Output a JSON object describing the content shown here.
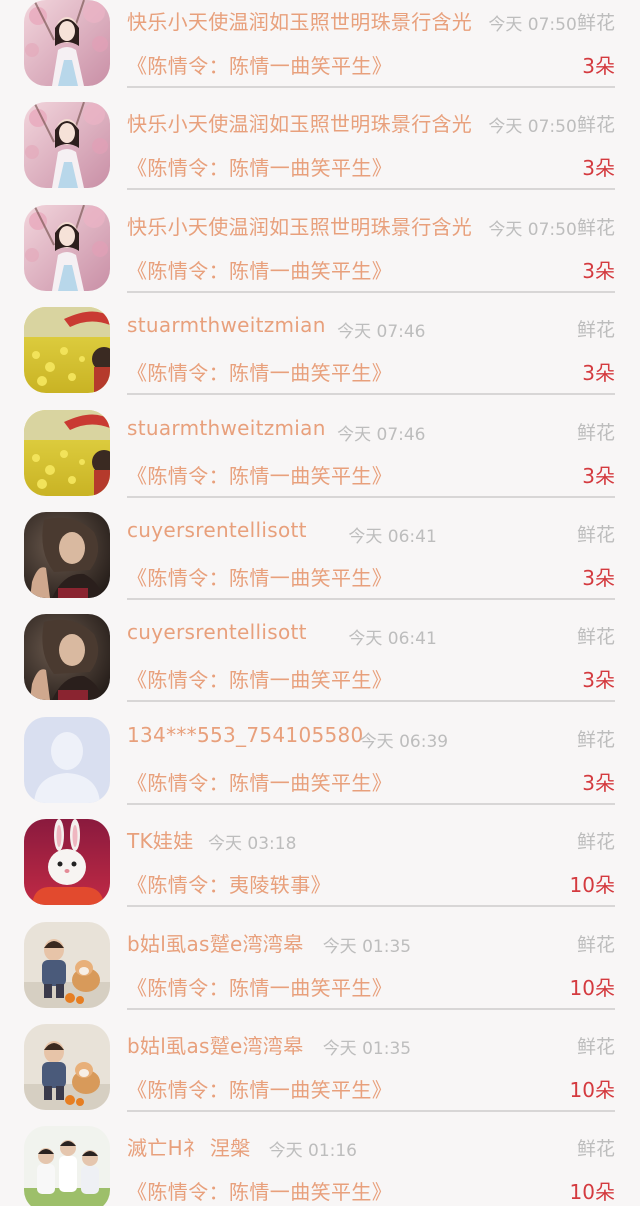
{
  "records": [
    {
      "avatar": "avatar-girl-pink-blossoms",
      "user": "快乐小天使温润如玉照世明珠景行含光",
      "time": "今天 07:50",
      "gift": "鲜花",
      "work": "《陈情令：陈情一曲笑平生》",
      "count": "3朵"
    },
    {
      "avatar": "avatar-girl-pink-blossoms",
      "user": "快乐小天使温润如玉照世明珠景行含光",
      "time": "今天 07:50",
      "gift": "鲜花",
      "work": "《陈情令：陈情一曲笑平生》",
      "count": "3朵"
    },
    {
      "avatar": "avatar-girl-pink-blossoms",
      "user": "快乐小天使温润如玉照世明珠景行含光",
      "time": "今天 07:50",
      "gift": "鲜花",
      "work": "《陈情令：陈情一曲笑平生》",
      "count": "3朵"
    },
    {
      "avatar": "avatar-yellow-flower-field",
      "user": "stuarmthweitzmian",
      "time": "今天 07:46",
      "gift": "鲜花",
      "work": "《陈情令：陈情一曲笑平生》",
      "count": "3朵"
    },
    {
      "avatar": "avatar-yellow-flower-field",
      "user": "stuarmthweitzmian",
      "time": "今天 07:46",
      "gift": "鲜花",
      "work": "《陈情令：陈情一曲笑平生》",
      "count": "3朵"
    },
    {
      "avatar": "avatar-woman-looking-up",
      "user": "cuyersrentellisott",
      "time": "今天 06:41",
      "gift": "鲜花",
      "work": "《陈情令：陈情一曲笑平生》",
      "count": "3朵"
    },
    {
      "avatar": "avatar-woman-looking-up",
      "user": "cuyersrentellisott",
      "time": "今天 06:41",
      "gift": "鲜花",
      "work": "《陈情令：陈情一曲笑平生》",
      "count": "3朵"
    },
    {
      "avatar": "avatar-default-placeholder",
      "user": "134***553_754105580",
      "time": "今天 06:39",
      "gift": "鲜花",
      "work": "《陈情令：陈情一曲笑平生》",
      "count": "3朵"
    },
    {
      "avatar": "avatar-white-rabbit",
      "user": "TK娃娃",
      "time": "今天 03:18",
      "gift": "鲜花",
      "work": "《陈情令：夷陵轶事》",
      "count": "10朵"
    },
    {
      "avatar": "avatar-child-with-dog",
      "user": "b姑l虱as蹵e湾湾皋",
      "time": "今天 01:35",
      "gift": "鲜花",
      "work": "《陈情令：陈情一曲笑平生》",
      "count": "10朵"
    },
    {
      "avatar": "avatar-child-with-dog",
      "user": "b姑l虱as蹵e湾湾皋",
      "time": "今天 01:35",
      "gift": "鲜花",
      "work": "《陈情令：陈情一曲笑平生》",
      "count": "10朵"
    },
    {
      "avatar": "avatar-group-photo",
      "user": "滅亡H礻 涅槃",
      "time": "今天 01:16",
      "gift": "鲜花",
      "work": "《陈情令：陈情一曲笑平生》",
      "count": "10朵"
    }
  ]
}
